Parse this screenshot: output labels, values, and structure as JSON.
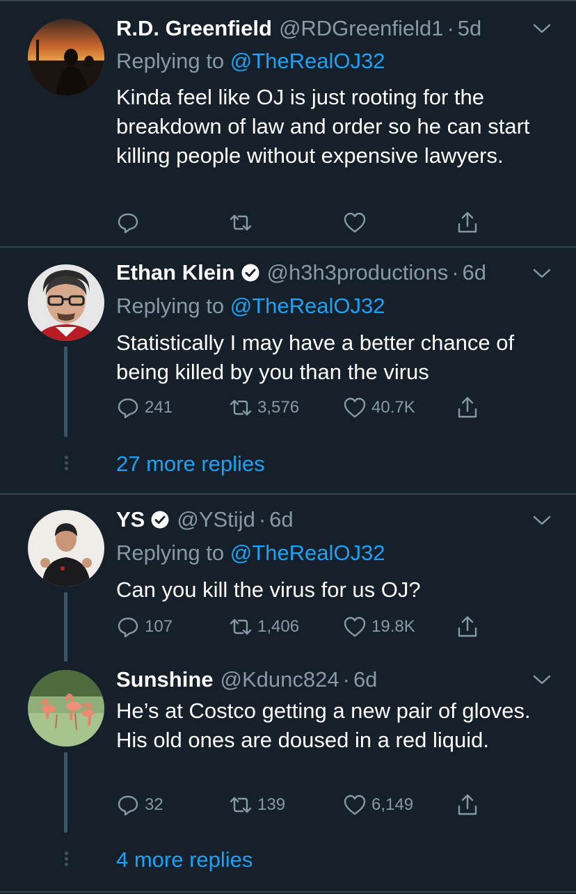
{
  "colors": {
    "background": "#15202b",
    "divider": "#38444d",
    "secondary_text": "#8899a6",
    "accent": "#1da1f2",
    "thread_line": "#3d5466"
  },
  "icons": [
    "reply-icon",
    "retweet-icon",
    "like-icon",
    "share-icon",
    "chevron-down-icon",
    "verified-badge-icon",
    "more-dots-icon"
  ],
  "tweets": [
    {
      "name": "R.D. Greenfield",
      "verified": false,
      "handle": "@RDGreenfield1",
      "separator": "·",
      "time": "5d",
      "replying_prefix": "Replying to",
      "replying_to": "@TheRealOJ32",
      "text": "Kinda feel like OJ is just rooting for the breakdown of law and order so he can start killing people without expensive lawyers.",
      "replies": "",
      "retweets": "",
      "likes": ""
    },
    {
      "name": "Ethan Klein",
      "verified": true,
      "handle": "@h3h3productions",
      "separator": "·",
      "time": "6d",
      "replying_prefix": "Replying to",
      "replying_to": "@TheRealOJ32",
      "text": "Statistically I may have a better chance of being killed by you than the virus",
      "replies": "241",
      "retweets": "3,576",
      "likes": "40.7K",
      "more_replies": "27 more replies"
    },
    {
      "name": "YS",
      "verified": true,
      "handle": "@YStijd",
      "separator": "·",
      "time": "6d",
      "replying_prefix": "Replying to",
      "replying_to": "@TheRealOJ32",
      "text": "Can you kill the virus for us OJ?",
      "replies": "107",
      "retweets": "1,406",
      "likes": "19.8K"
    },
    {
      "name": "Sunshine",
      "verified": false,
      "handle": "@Kdunc824",
      "separator": "·",
      "time": "6d",
      "text": "He’s at Costco getting a new pair of gloves.  His old ones are doused in a red liquid.",
      "replies": "32",
      "retweets": "139",
      "likes": "6,149",
      "more_replies": "4 more replies"
    }
  ]
}
